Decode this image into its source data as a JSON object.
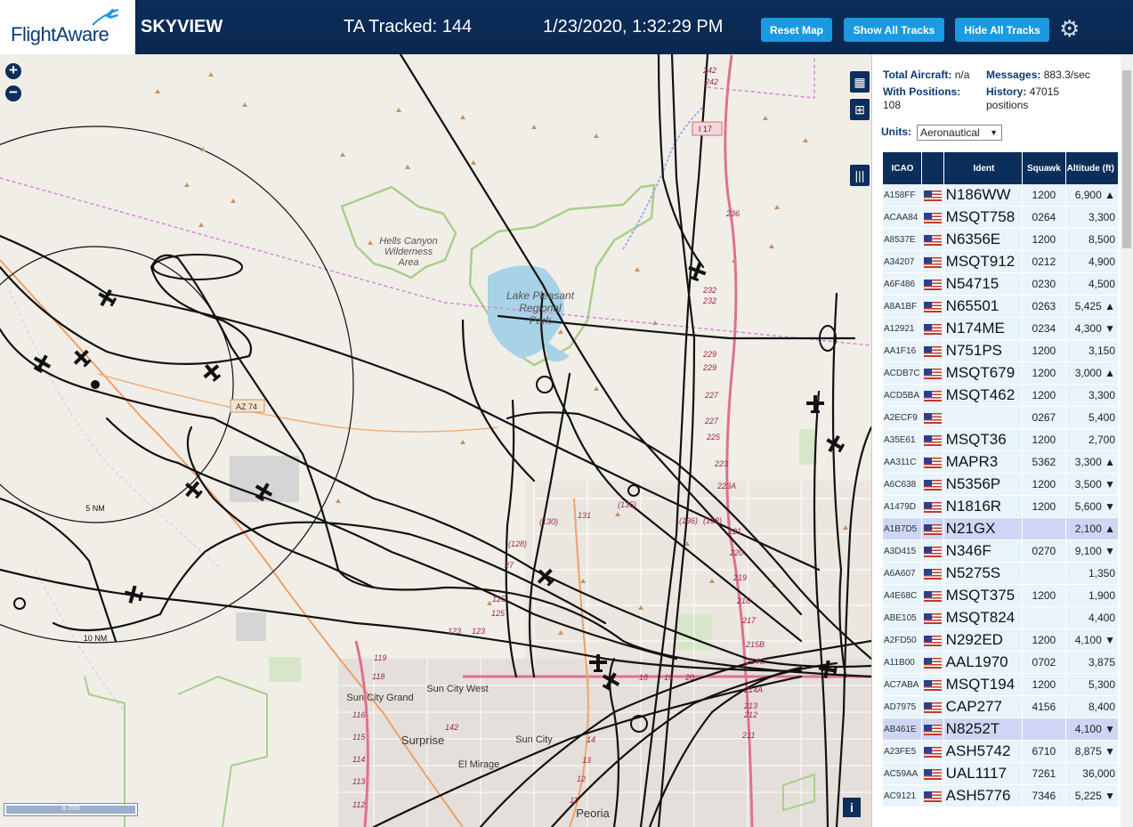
{
  "header": {
    "logo": "FlightAware",
    "app_title": "SKYVIEW",
    "tracked": "TA Tracked: 144",
    "datetime": "1/23/2020, 1:32:29 PM",
    "buttons": {
      "reset": "Reset Map",
      "show_all": "Show All Tracks",
      "hide_all": "Hide All Tracks"
    },
    "settings_icon": "gear-icon"
  },
  "map": {
    "zoom_in": "+",
    "zoom_out": "−",
    "scale_label": "5 nm",
    "ring_labels": [
      "5 NM",
      "10 NM"
    ],
    "places": {
      "hells_canyon": [
        "Hells Canyon",
        "Wilderness",
        "Area"
      ],
      "lake": [
        "Lake Pleasant",
        "Regional",
        "Park"
      ],
      "sun_city_grand": "Sun City Grand",
      "sun_city_west": "Sun City West",
      "surprise": "Surprise",
      "sun_city": "Sun City",
      "el_mirage": "El Mirage",
      "peoria": "Peoria"
    },
    "road_shields": [
      "I 17",
      "AZ 74"
    ],
    "mile_labels": [
      "242",
      "242",
      "236",
      "232",
      "232",
      "229",
      "229",
      "227",
      "227",
      "225",
      "223",
      "223A",
      "221",
      "220",
      "219",
      "218",
      "217",
      "215B",
      "214C",
      "214A",
      "213",
      "212",
      "211",
      "131",
      "(130)",
      "(135)",
      "(136)",
      "(138)",
      "(128)",
      "27",
      "125",
      "125",
      "123",
      "123",
      "119",
      "118",
      "116",
      "115",
      "114",
      "113",
      "112",
      "142",
      "14",
      "13",
      "12",
      "11",
      "18",
      "19",
      "20"
    ],
    "controls": {
      "map_icon": "map-icon",
      "grid_icon": "grid-icon",
      "columns_icon": "columns-icon",
      "info_icon": "i"
    }
  },
  "panel": {
    "stats": {
      "total_label": "Total Aircraft:",
      "total_value": "n/a",
      "messages_label": "Messages:",
      "messages_value": "883.3/sec",
      "positions_label": "With Positions:",
      "positions_value": "108",
      "history_label": "History:",
      "history_value": "47015",
      "history_unit": "positions"
    },
    "units_label": "Units:",
    "units_value": "Aeronautical",
    "columns": [
      "ICAO",
      "",
      "Ident",
      "Squawk",
      "Altitude (ft)"
    ],
    "rows": [
      {
        "icao": "A158FF",
        "ident": "N186WW",
        "squawk": "1200",
        "alt": "6,900 ▲"
      },
      {
        "icao": "ACAA84",
        "ident": "MSQT758",
        "squawk": "0264",
        "alt": "3,300"
      },
      {
        "icao": "A8537E",
        "ident": "N6356E",
        "squawk": "1200",
        "alt": "8,500"
      },
      {
        "icao": "A34207",
        "ident": "MSQT912",
        "squawk": "0212",
        "alt": "4,900"
      },
      {
        "icao": "A6F486",
        "ident": "N54715",
        "squawk": "0230",
        "alt": "4,500"
      },
      {
        "icao": "A8A1BF",
        "ident": "N65501",
        "squawk": "0263",
        "alt": "5,425 ▲"
      },
      {
        "icao": "A12921",
        "ident": "N174ME",
        "squawk": "0234",
        "alt": "4,300 ▼"
      },
      {
        "icao": "AA1F16",
        "ident": "N751PS",
        "squawk": "1200",
        "alt": "3,150"
      },
      {
        "icao": "ACDB7C",
        "ident": "MSQT679",
        "squawk": "1200",
        "alt": "3,000 ▲"
      },
      {
        "icao": "ACD5BA",
        "ident": "MSQT462",
        "squawk": "1200",
        "alt": "3,300"
      },
      {
        "icao": "A2ECF9",
        "ident": "",
        "squawk": "0267",
        "alt": "5,400"
      },
      {
        "icao": "A35E61",
        "ident": "MSQT36",
        "squawk": "1200",
        "alt": "2,700"
      },
      {
        "icao": "AA311C",
        "ident": "MAPR3",
        "squawk": "5362",
        "alt": "3,300 ▲"
      },
      {
        "icao": "A6C638",
        "ident": "N5356P",
        "squawk": "1200",
        "alt": "3,500 ▼"
      },
      {
        "icao": "A1479D",
        "ident": "N1816R",
        "squawk": "1200",
        "alt": "5,600 ▼"
      },
      {
        "icao": "A1B7D5",
        "ident": "N21GX",
        "squawk": "",
        "alt": "2,100 ▲",
        "hl": true
      },
      {
        "icao": "A3D415",
        "ident": "N346F",
        "squawk": "0270",
        "alt": "9,100 ▼"
      },
      {
        "icao": "A6A607",
        "ident": "N5275S",
        "squawk": "",
        "alt": "1,350"
      },
      {
        "icao": "A4E68C",
        "ident": "MSQT375",
        "squawk": "1200",
        "alt": "1,900"
      },
      {
        "icao": "ABE105",
        "ident": "MSQT824",
        "squawk": "",
        "alt": "4,400"
      },
      {
        "icao": "A2FD50",
        "ident": "N292ED",
        "squawk": "1200",
        "alt": "4,100 ▼"
      },
      {
        "icao": "A11B00",
        "ident": "AAL1970",
        "squawk": "0702",
        "alt": "3,875"
      },
      {
        "icao": "AC7ABA",
        "ident": "MSQT194",
        "squawk": "1200",
        "alt": "5,300"
      },
      {
        "icao": "AD7975",
        "ident": "CAP277",
        "squawk": "4156",
        "alt": "8,400"
      },
      {
        "icao": "AB461E",
        "ident": "N8252T",
        "squawk": "",
        "alt": "4,100 ▼",
        "hl": true
      },
      {
        "icao": "A23FE5",
        "ident": "ASH5742",
        "squawk": "6710",
        "alt": "8,875 ▼"
      },
      {
        "icao": "AC59AA",
        "ident": "UAL1117",
        "squawk": "7261",
        "alt": "36,000"
      },
      {
        "icao": "AC9121",
        "ident": "ASH5776",
        "squawk": "7346",
        "alt": "5,225 ▼"
      }
    ]
  },
  "colors": {
    "header": "#0c2e5a",
    "button": "#1a9ae0",
    "row": "#e8f3fb",
    "highlight": "#cfd6f5",
    "track": "#111111",
    "highway": "#e07090",
    "park_border": "#a8cf8a",
    "water": "#a8d2e6"
  }
}
